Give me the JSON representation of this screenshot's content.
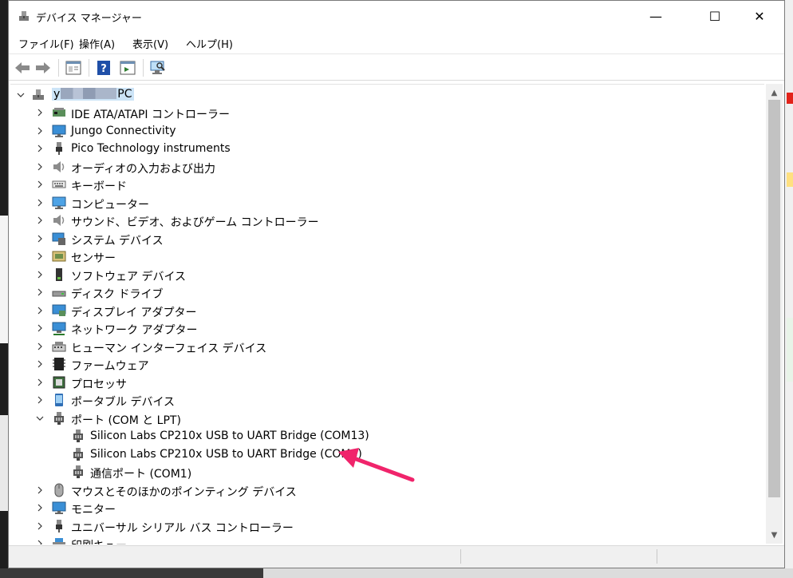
{
  "window": {
    "title": "デバイス マネージャー",
    "controls": {
      "minimize": "—",
      "maximize": "☐",
      "close": "✕"
    }
  },
  "menu": {
    "items": [
      {
        "label": "ファイル(F)"
      },
      {
        "label": "操作(A)"
      },
      {
        "label": "表示(V)"
      },
      {
        "label": "ヘルプ(H)"
      }
    ]
  },
  "toolbar": {
    "buttons": [
      "back-icon",
      "forward-icon",
      "properties-icon",
      "help-icon",
      "view-icon",
      "scan-hardware-icon"
    ]
  },
  "tree": {
    "root": {
      "prefix": "y",
      "suffix": "PC",
      "redacted": true
    },
    "items": [
      {
        "label": "IDE ATA/ATAPI コントローラー",
        "icon": "ide-controller-icon",
        "expanded": false
      },
      {
        "label": "Jungo Connectivity",
        "icon": "monitor-icon",
        "expanded": false
      },
      {
        "label": "Pico Technology instruments",
        "icon": "usb-plug-icon",
        "expanded": false
      },
      {
        "label": "オーディオの入力および出力",
        "icon": "speaker-icon",
        "expanded": false
      },
      {
        "label": "キーボード",
        "icon": "keyboard-icon",
        "expanded": false
      },
      {
        "label": "コンピューター",
        "icon": "computer-icon",
        "expanded": false
      },
      {
        "label": "サウンド、ビデオ、およびゲーム コントローラー",
        "icon": "speaker-icon",
        "expanded": false
      },
      {
        "label": "システム デバイス",
        "icon": "system-device-icon",
        "expanded": false
      },
      {
        "label": "センサー",
        "icon": "sensor-icon",
        "expanded": false
      },
      {
        "label": "ソフトウェア デバイス",
        "icon": "software-device-icon",
        "expanded": false
      },
      {
        "label": "ディスク ドライブ",
        "icon": "disk-drive-icon",
        "expanded": false
      },
      {
        "label": "ディスプレイ アダプター",
        "icon": "display-adapter-icon",
        "expanded": false
      },
      {
        "label": "ネットワーク アダプター",
        "icon": "network-adapter-icon",
        "expanded": false
      },
      {
        "label": "ヒューマン インターフェイス デバイス",
        "icon": "hid-icon",
        "expanded": false
      },
      {
        "label": "ファームウェア",
        "icon": "firmware-icon",
        "expanded": false
      },
      {
        "label": "プロセッサ",
        "icon": "processor-icon",
        "expanded": false
      },
      {
        "label": "ポータブル デバイス",
        "icon": "portable-device-icon",
        "expanded": false
      },
      {
        "label": "ポート (COM と LPT)",
        "icon": "port-icon",
        "expanded": true,
        "children": [
          {
            "label": "Silicon Labs CP210x USB to UART Bridge (COM13)",
            "icon": "port-icon"
          },
          {
            "label": "Silicon Labs CP210x USB to UART Bridge (COM8)",
            "icon": "port-icon"
          },
          {
            "label": "通信ポート (COM1)",
            "icon": "port-icon"
          }
        ]
      },
      {
        "label": "マウスとそのほかのポインティング デバイス",
        "icon": "mouse-icon",
        "expanded": false
      },
      {
        "label": "モニター",
        "icon": "monitor-icon",
        "expanded": false
      },
      {
        "label": "ユニバーサル シリアル バス コントローラー",
        "icon": "usb-plug-icon",
        "expanded": false
      },
      {
        "label": "印刷キュー",
        "icon": "printer-icon",
        "expanded": false
      }
    ]
  },
  "colors": {
    "selection": "#cce4f7",
    "annotation_arrow": "#f0246b",
    "scroll_thumb": "#c2c2c2"
  }
}
